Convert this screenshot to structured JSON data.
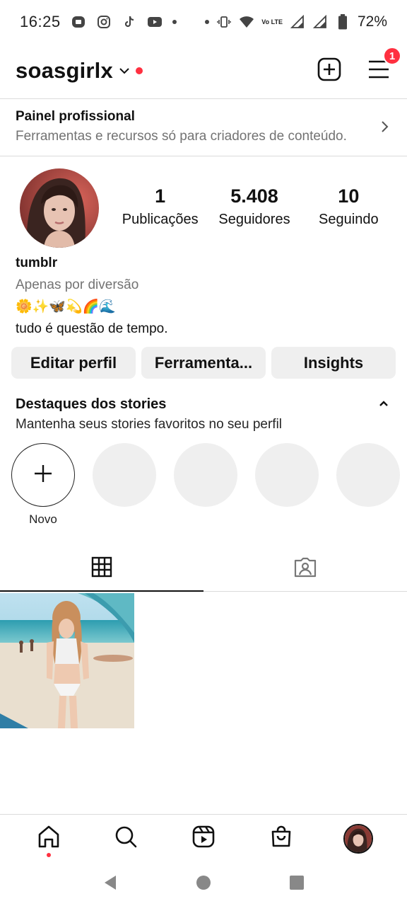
{
  "status_bar": {
    "time": "16:25",
    "battery": "72%",
    "network_label": "Vo LTE"
  },
  "header": {
    "username": "soasgirlx",
    "menu_badge": "1"
  },
  "pro_panel": {
    "title": "Painel profissional",
    "subtitle": "Ferramentas e recursos só para criadores de conteúdo."
  },
  "profile": {
    "stats": [
      {
        "value": "1",
        "label": "Publicações"
      },
      {
        "value": "5.408",
        "label": "Seguidores"
      },
      {
        "value": "10",
        "label": "Seguindo"
      }
    ],
    "name": "tumblr",
    "category": "Apenas por diversão",
    "bio_emojis": "🌼✨🦋💫🌈🌊",
    "bio_text": "tudo é questão de tempo."
  },
  "buttons": {
    "edit": "Editar perfil",
    "tools": "Ferramenta...",
    "insights": "Insights"
  },
  "highlights": {
    "title": "Destaques dos stories",
    "subtitle": "Mantenha seus stories favoritos no seu perfil",
    "new_label": "Novo",
    "placeholders": 4
  },
  "icons": {
    "status_left": [
      "media-icon",
      "instagram-icon",
      "tiktok-icon",
      "youtube-icon"
    ],
    "status_right": [
      "vibrate-icon",
      "wifi-icon",
      "signal-icon",
      "battery-icon"
    ],
    "header": [
      "chevron-down-icon",
      "new-post-icon",
      "menu-icon"
    ],
    "tabs": [
      "grid-icon",
      "tagged-icon"
    ],
    "bottom_nav": [
      "home-icon",
      "search-icon",
      "reels-icon",
      "shop-icon",
      "profile-avatar"
    ],
    "system_nav": [
      "back-icon",
      "home-circle-icon",
      "recents-icon"
    ]
  },
  "colors": {
    "accent_red": "#ff3040",
    "button_bg": "#efefef",
    "secondary_text": "#737373"
  }
}
